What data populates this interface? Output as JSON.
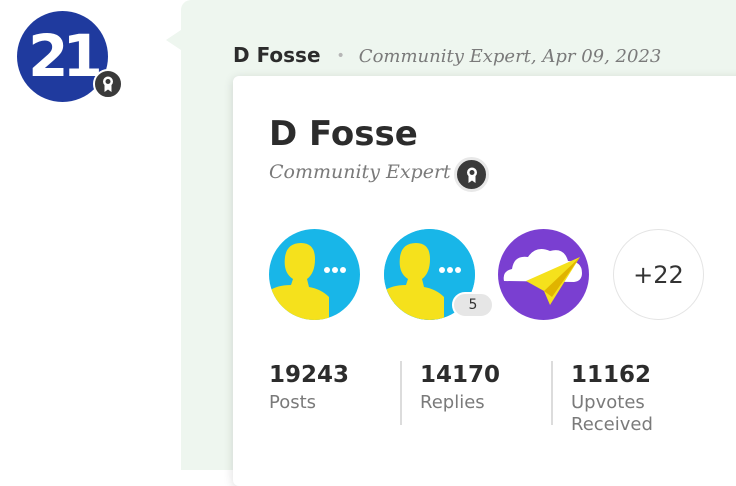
{
  "avatar": {
    "number_text": "21",
    "color": "#1f3a9e"
  },
  "post": {
    "author": "D Fosse",
    "separator": "•",
    "meta": "Community Expert, Apr 09, 2023"
  },
  "profile": {
    "name": "D Fosse",
    "rank": "Community Expert",
    "badges": [
      {
        "icon": "person-chat-badge-icon"
      },
      {
        "icon": "person-chat-badge-icon",
        "count": "5"
      },
      {
        "icon": "paper-plane-cloud-badge-icon"
      }
    ],
    "more_badges": "+22",
    "stats": [
      {
        "value": "19243",
        "label": "Posts"
      },
      {
        "value": "14170",
        "label": "Replies"
      },
      {
        "value": "11162",
        "label": "Upvotes Received"
      }
    ]
  },
  "colors": {
    "panel_bg": "#eef6ef",
    "badge_blue": "#18b6e8",
    "badge_yellow": "#f5e11c",
    "badge_purple": "#7a3fd1"
  }
}
